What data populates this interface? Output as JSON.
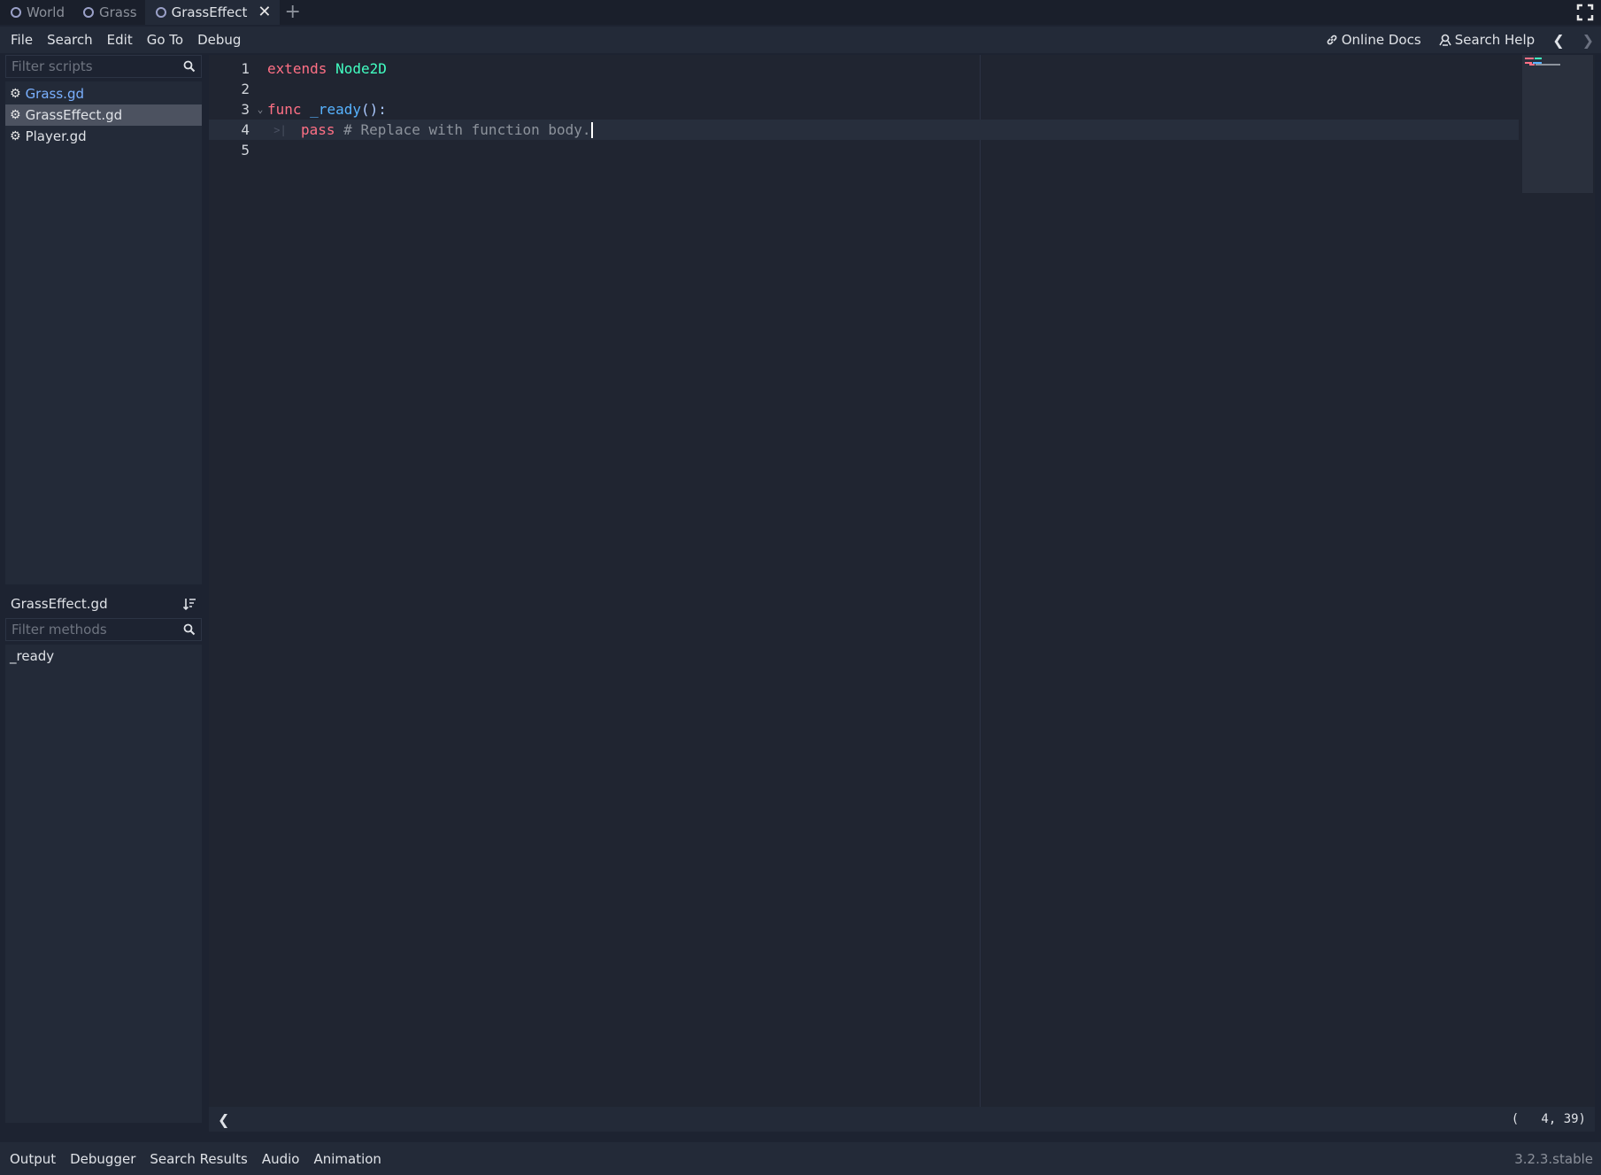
{
  "scene_tabs": [
    {
      "label": "World",
      "active": false
    },
    {
      "label": "Grass",
      "active": false
    },
    {
      "label": "GrassEffect",
      "active": true
    }
  ],
  "menu": {
    "items": [
      "File",
      "Search",
      "Edit",
      "Go To",
      "Debug"
    ],
    "online_docs": "Online Docs",
    "search_help": "Search Help"
  },
  "scripts": {
    "filter_placeholder": "Filter scripts",
    "items": [
      {
        "name": "Grass.gd",
        "state": "open"
      },
      {
        "name": "GrassEffect.gd",
        "state": "selected"
      },
      {
        "name": "Player.gd",
        "state": "normal"
      }
    ]
  },
  "methods": {
    "current_file": "GrassEffect.gd",
    "filter_placeholder": "Filter methods",
    "items": [
      "_ready"
    ]
  },
  "editor": {
    "lines": [
      {
        "number": "1",
        "tokens": [
          [
            "kw",
            "extends"
          ],
          [
            "plain",
            " "
          ],
          [
            "type",
            "Node2D"
          ]
        ]
      },
      {
        "number": "2",
        "tokens": []
      },
      {
        "number": "3",
        "tokens": [
          [
            "kw",
            "func"
          ],
          [
            "plain",
            " "
          ],
          [
            "fn",
            "_ready"
          ],
          [
            "sym",
            "():"
          ]
        ],
        "foldable": true
      },
      {
        "number": "4",
        "tokens": [
          [
            "kw",
            "pass"
          ],
          [
            "plain",
            " "
          ],
          [
            "cmt",
            "# Replace with function body."
          ]
        ],
        "indent": true,
        "current": true
      },
      {
        "number": "5",
        "tokens": []
      }
    ],
    "cursor_position": "(   4, 39)"
  },
  "bottom_tabs": [
    "Output",
    "Debugger",
    "Search Results",
    "Audio",
    "Animation"
  ],
  "version": "3.2.3.stable",
  "colors": {
    "keyword": "#ff7085",
    "type": "#42ffc2",
    "function": "#57b3ff",
    "comment": "#8d939c",
    "open_script": "#7ab0ff"
  }
}
